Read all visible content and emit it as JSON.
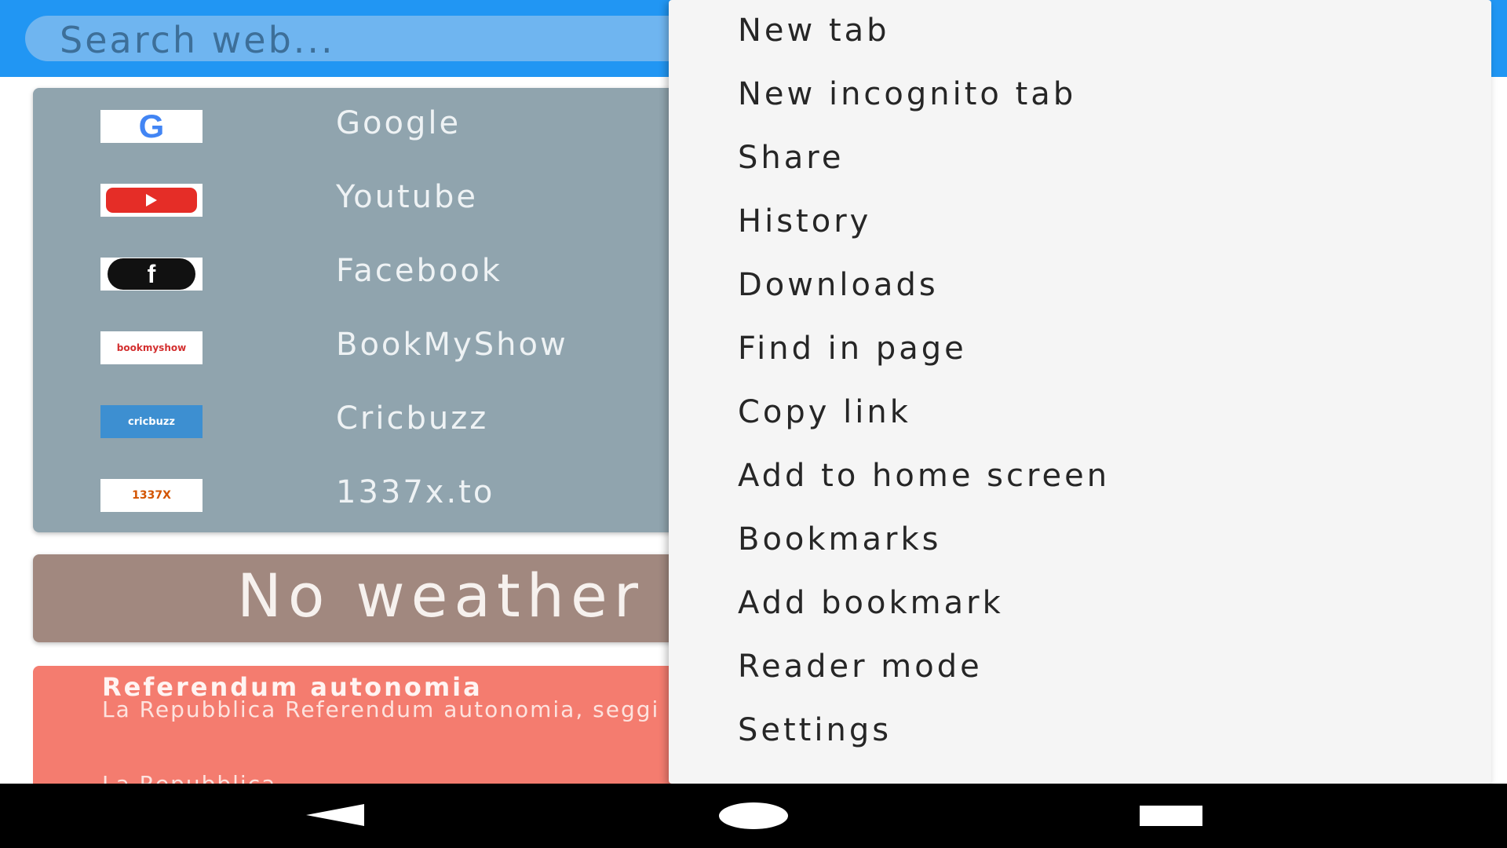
{
  "search": {
    "placeholder": "Search web..."
  },
  "quick_links": [
    {
      "label": "Google",
      "icon": "google-logo"
    },
    {
      "label": "Youtube",
      "icon": "youtube-logo"
    },
    {
      "label": "Facebook",
      "icon": "facebook-logo"
    },
    {
      "label": "BookMyShow",
      "icon": "bookmyshow-logo",
      "thumb_text": "bookmyshow"
    },
    {
      "label": "Cricbuzz",
      "icon": "cricbuzz-logo",
      "thumb_text": "cricbuzz"
    },
    {
      "label": "1337x.to",
      "icon": "1337x-logo",
      "thumb_text": "1337X"
    }
  ],
  "weather": {
    "text": "No weather"
  },
  "news": {
    "title": "Referendum autonomia",
    "body": "La Repubblica Referendum autonomia, seggi aperti in Veneto e Lombardia",
    "source": "La Repubblica"
  },
  "menu": {
    "items": [
      "New tab",
      "New incognito tab",
      "Share",
      "History",
      "Downloads",
      "Find in page",
      "Copy link",
      "Add to home screen",
      "Bookmarks",
      "Add bookmark",
      "Reader mode",
      "Settings"
    ]
  },
  "colors": {
    "toolbar": "#2196f3",
    "links_card": "#90a4ae",
    "weather_card": "#a1887f",
    "news_card": "#f47c6f",
    "menu_bg": "#f5f5f5"
  },
  "navbar": {
    "icons": [
      "back-icon",
      "home-icon",
      "recents-icon"
    ]
  }
}
